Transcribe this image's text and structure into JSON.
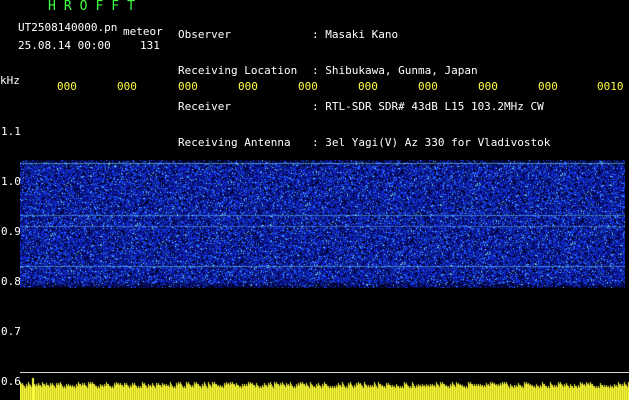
{
  "header": {
    "title": "HROFFT",
    "filename": "UT2508140000.pn",
    "mode": "meteor",
    "timestamp": "25.08.14 00:00",
    "count": "131",
    "fields": [
      {
        "label": "Observer",
        "value": ": Masaki Kano"
      },
      {
        "label": "Receiving Location",
        "value": ": Shibukawa, Gunma, Japan"
      },
      {
        "label": "Receiver",
        "value": ": RTL-SDR SDR# 43dB L15 103.2MHz CW"
      },
      {
        "label": "Receiving Antenna",
        "value": ": 3el Yagi(V) Az 330 for Vladivostok"
      }
    ]
  },
  "axis": {
    "unit": "kHz",
    "y_ticks": [
      "1.1",
      "1.0",
      "0.9",
      "0.8",
      "0.7",
      "0.6"
    ],
    "x_ticks": [
      "000",
      "000",
      "000",
      "000",
      "000",
      "000",
      "000",
      "000",
      "000",
      "0010"
    ]
  },
  "colors": {
    "label_green": "#40ff40",
    "tick_yellow": "#ffff40",
    "noise_blue": "#1a3cff"
  }
}
